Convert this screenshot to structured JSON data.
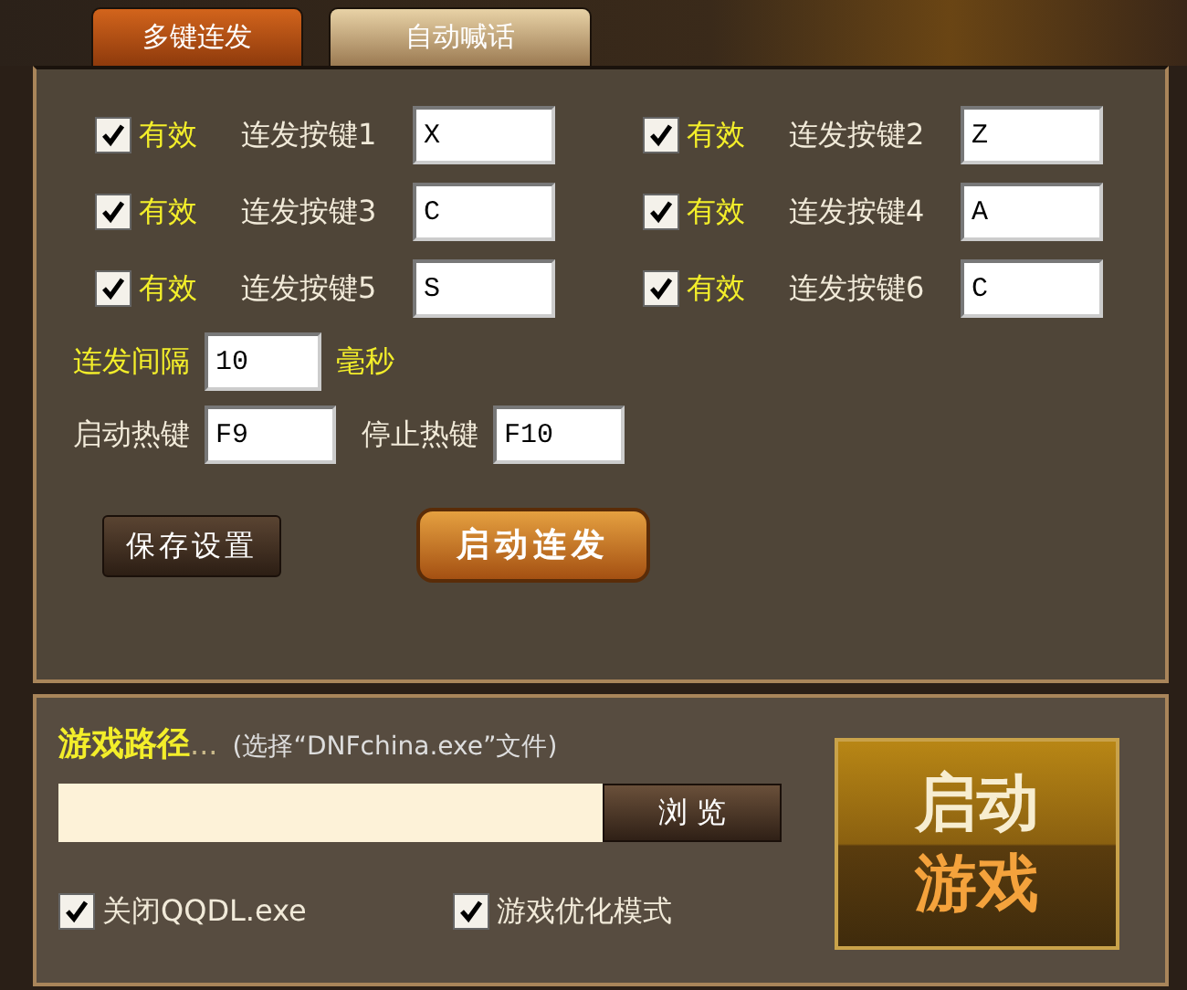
{
  "tabs": [
    {
      "label": "多键连发",
      "selected": true
    },
    {
      "label": "自动喊话",
      "selected": false
    }
  ],
  "keys": [
    {
      "enabled_label": "有效",
      "checked": true,
      "label": "连发按键1",
      "value": "X"
    },
    {
      "enabled_label": "有效",
      "checked": true,
      "label": "连发按键2",
      "value": "Z"
    },
    {
      "enabled_label": "有效",
      "checked": true,
      "label": "连发按键3",
      "value": "C"
    },
    {
      "enabled_label": "有效",
      "checked": true,
      "label": "连发按键4",
      "value": "A"
    },
    {
      "enabled_label": "有效",
      "checked": true,
      "label": "连发按键5",
      "value": "S"
    },
    {
      "enabled_label": "有效",
      "checked": true,
      "label": "连发按键6",
      "value": "C"
    }
  ],
  "interval": {
    "label": "连发间隔",
    "value": "10",
    "unit": "毫秒"
  },
  "hotkeys": [
    {
      "label": "启动热键",
      "value": "F9"
    },
    {
      "label": "停止热键",
      "value": "F10"
    }
  ],
  "buttons": {
    "save": "保存设置",
    "start": "启动连发"
  },
  "game_path": {
    "label": "游戏路径",
    "ellipsis": "...",
    "hint": "(选择“DNFchina.exe”文件)",
    "browse": "浏 览"
  },
  "options": [
    {
      "label": "关闭QQDL.exe",
      "checked": true
    },
    {
      "label": "游戏优化模式",
      "checked": true
    }
  ],
  "launch": {
    "line_1": "启动",
    "line_2": "游戏"
  }
}
